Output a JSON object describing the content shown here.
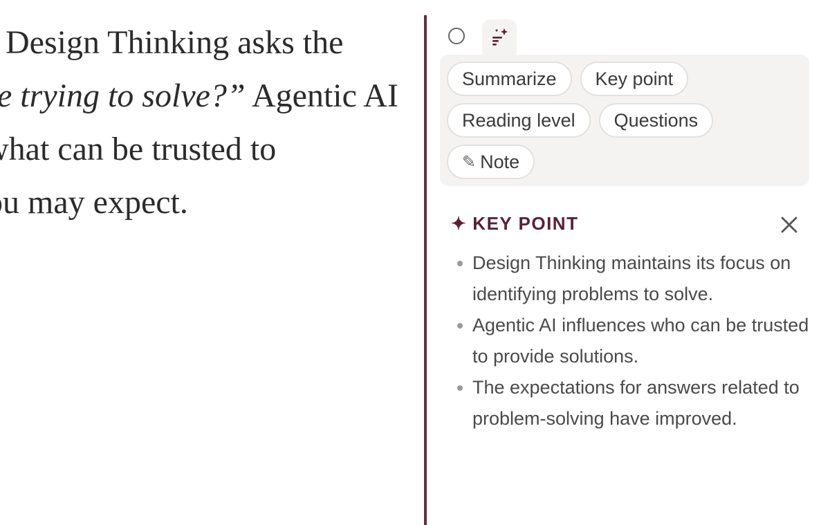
{
  "reading": {
    "line1": "Design Thinking asks the",
    "line2_italic": "e trying to solve?”",
    "line2_rest": " Agentic AI",
    "line3": "what can be trusted to",
    "line4": "ou may expect."
  },
  "panel": {
    "tabs": {
      "circle": "circle-icon",
      "sparkle": "sparkle-lines-icon"
    },
    "actions": {
      "summarize": "Summarize",
      "key_point": "Key point",
      "reading_level": "Reading level",
      "questions": "Questions",
      "note": "Note",
      "note_icon": "✎"
    },
    "result": {
      "title": "KEY POINT",
      "title_icon": "✦",
      "bullets": [
        "Design Thinking maintains its focus on identifying problems to solve.",
        "Agentic AI influences who can be trusted to provide solutions.",
        "The expectations for answers related to problem-solving have improved."
      ]
    }
  },
  "colors": {
    "accent": "#5b1f35",
    "divider": "#6b2a3d",
    "panel_bg": "#f4f3f1"
  }
}
